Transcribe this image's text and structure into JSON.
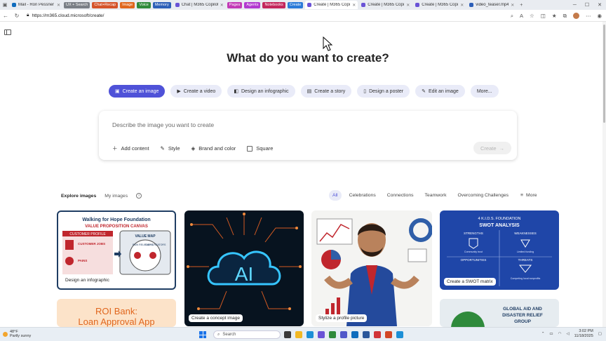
{
  "browser": {
    "tabs": [
      {
        "label": "Mail - Ron Pessner -",
        "fav": "#0f6cbd"
      },
      {
        "label": "UX + Search",
        "group": true,
        "color": "#7a7f86"
      },
      {
        "label": "Chat+Recap",
        "group": true,
        "color": "#d5532a"
      },
      {
        "label": "Image",
        "group": true,
        "color": "#e0661d"
      },
      {
        "label": "Voice",
        "group": true,
        "color": "#2f8a3b"
      },
      {
        "label": "Memory",
        "group": true,
        "color": "#2d5fb8"
      },
      {
        "label": "Chat | M365 Copilot",
        "fav": "#6a53d6"
      },
      {
        "label": "Pages",
        "group": true,
        "color": "#c23ab6"
      },
      {
        "label": "Agents",
        "group": true,
        "color": "#b23ad0"
      },
      {
        "label": "Notebooks",
        "group": true,
        "color": "#c3265c"
      },
      {
        "label": "Create",
        "group": true,
        "color": "#2a7ad8"
      },
      {
        "label": "Create | M365 Copil",
        "fav": "#6a53d6",
        "active": true
      },
      {
        "label": "Create | M365 Copil",
        "fav": "#6a53d6"
      },
      {
        "label": "Create | M365 Copil",
        "fav": "#6a53d6"
      },
      {
        "label": "video_teaser.mp4",
        "fav": "#2d5fb8"
      }
    ],
    "url": "https://m365.cloud.microsoft/create/"
  },
  "page": {
    "title": "What do you want to create?",
    "chips": [
      {
        "label": "Create an image",
        "icon": "image-icon",
        "active": true
      },
      {
        "label": "Create a video",
        "icon": "video-icon"
      },
      {
        "label": "Design an infographic",
        "icon": "infographic-icon"
      },
      {
        "label": "Create a story",
        "icon": "story-icon"
      },
      {
        "label": "Design a poster",
        "icon": "poster-icon"
      },
      {
        "label": "Edit an image",
        "icon": "edit-image-icon"
      },
      {
        "label": "More...",
        "icon": ""
      }
    ],
    "prompt": {
      "placeholder": "Describe the image you want to create",
      "add_content": "Add content",
      "style": "Style",
      "brand": "Brand and color",
      "square": "Square",
      "create": "Create"
    },
    "explore": {
      "tabs": [
        "Explore images",
        "My images"
      ],
      "filters": [
        "All",
        "Celebrations",
        "Connections",
        "Teamwork",
        "Overcoming Challenges"
      ],
      "more": "More"
    },
    "cards": [
      {
        "label": "Design an infographic",
        "title": "Walking for Hope Foundation",
        "subtitle": "VALUE PROPOSITION CANVAS",
        "left": "CUSTOMER PROFILE",
        "right": "VALUE MAP",
        "items": [
          "CUSTOMER JOBS",
          "PAINS",
          "PAIN RELIEVERS",
          "GAIN CREATORS"
        ]
      },
      {
        "label": "Create a concept image",
        "center": "AI"
      },
      {
        "label": "Stylize a profile picture"
      },
      {
        "label": "Create a SWOT matrix",
        "title": "4 K.I.D.S. FOUNDATION",
        "subtitle": "SWOT ANALYSIS",
        "quadrants": [
          "STRENGTHS",
          "WEAKNESSES",
          "OPPORTUNITIES",
          "THREATS"
        ],
        "notes": [
          "Community trust",
          "Limited funding",
          "Competing local nonprofits"
        ]
      },
      {
        "title": "ROI Bank:",
        "subtitle": "Loan Approval App"
      },
      {
        "title": "GLOBAL AID AND",
        "subtitle": "DISASTER RELIEF",
        "line3": "GROUP"
      }
    ]
  },
  "taskbar": {
    "temp": "48°F",
    "weather": "Partly sunny",
    "search": "Search",
    "time": "3:02 PM",
    "date": "11/18/2025"
  }
}
